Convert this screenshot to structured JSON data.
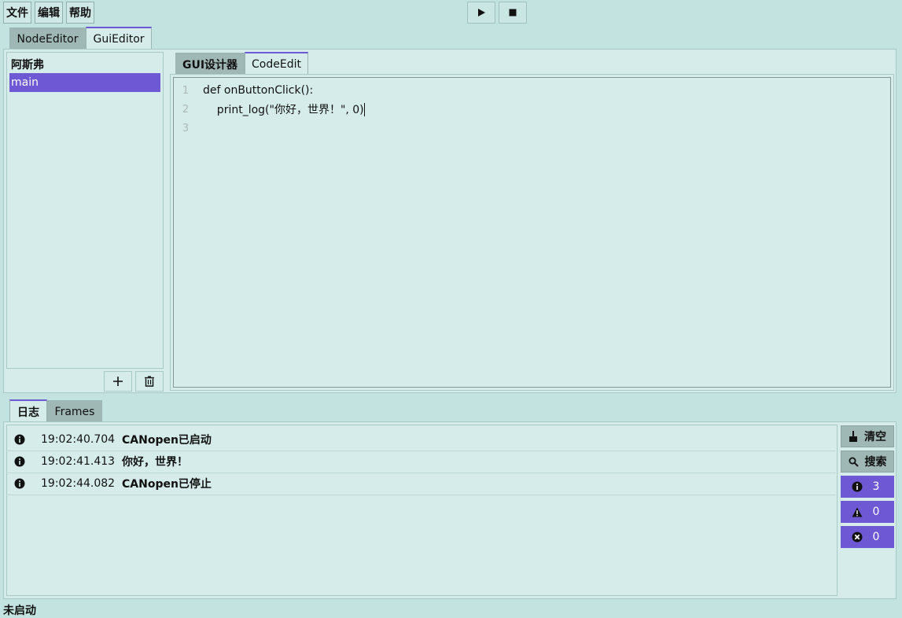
{
  "menu": {
    "file": "文件",
    "edit": "编辑",
    "help": "帮助"
  },
  "toolbar": {
    "run_icon": "play-icon",
    "stop_icon": "stop-icon"
  },
  "top_tabs": [
    {
      "label": "NodeEditor"
    },
    {
      "label": "GuiEditor"
    }
  ],
  "tree": {
    "root": "阿斯弗",
    "items": [
      {
        "label": "main"
      }
    ]
  },
  "editor_tabs": [
    {
      "label": "GUI设计器"
    },
    {
      "label": "CodeEdit"
    }
  ],
  "code": {
    "lines": [
      {
        "no": "1",
        "text": "def onButtonClick():"
      },
      {
        "no": "2",
        "text": "    print_log(\"你好，世界！\", 0)"
      },
      {
        "no": "3",
        "text": ""
      }
    ]
  },
  "bottom_tabs": [
    {
      "label": "日志"
    },
    {
      "label": "Frames"
    }
  ],
  "log": {
    "rows": [
      {
        "time": "19:02:40.704",
        "message": "CANopen已启动"
      },
      {
        "time": "19:02:41.413",
        "message": "你好，世界！"
      },
      {
        "time": "19:02:44.082",
        "message": "CANopen已停止"
      }
    ],
    "clear_label": "清空",
    "search_label": "搜索",
    "info_count": "3",
    "warning_count": "0",
    "error_count": "0"
  },
  "status": {
    "text": "未启动"
  },
  "colors": {
    "accent": "#6f58d4",
    "background": "#c3e3e0",
    "panel": "#d6ecea",
    "tab_inactive": "#9fb8b5"
  }
}
